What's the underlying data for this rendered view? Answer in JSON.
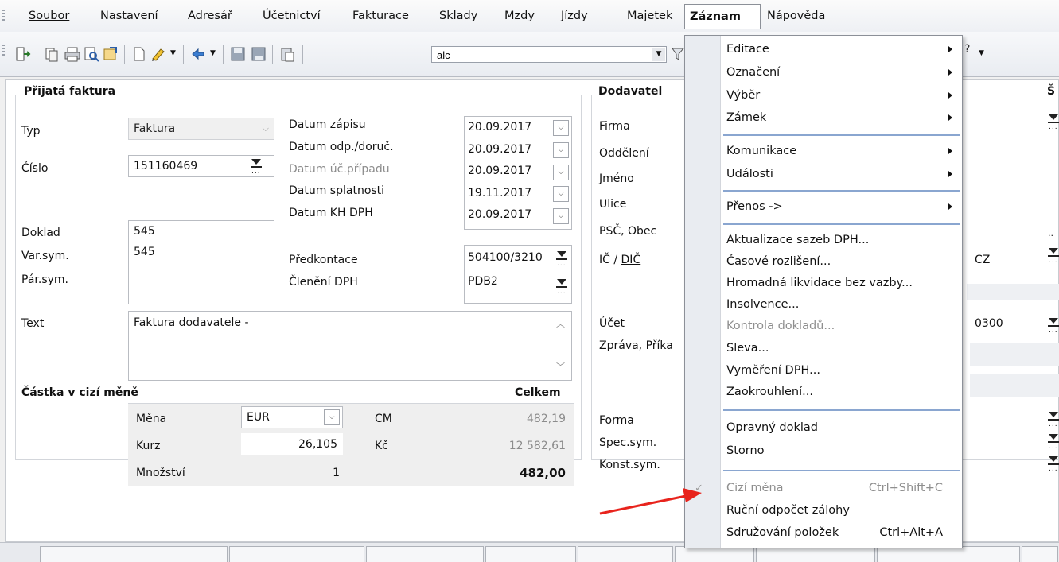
{
  "menubar": {
    "items": [
      "Soubor",
      "Nastavení",
      "Adresář",
      "Účetnictví",
      "Fakturace",
      "Sklady",
      "Mzdy",
      "Jízdy",
      "Majetek",
      "Záznam",
      "Nápověda"
    ],
    "active": "Záznam"
  },
  "toolbar": {
    "search_value": "alc"
  },
  "invoice": {
    "section_title": "Přijatá faktura",
    "typ_label": "Typ",
    "typ_value": "Faktura",
    "cislo_label": "Číslo",
    "cislo_value": "151160469",
    "doklad_label": "Doklad",
    "doklad_value": "545",
    "varsym_label": "Var.sym.",
    "varsym_value": "545",
    "parsym_label": "Pár.sym.",
    "parsym_value": "",
    "text_label": "Text",
    "text_value": "Faktura dodavatele -",
    "dates": [
      {
        "label": "Datum zápisu",
        "value": "20.09.2017",
        "dim": false
      },
      {
        "label": "Datum odp./doruč.",
        "value": "20.09.2017",
        "dim": false
      },
      {
        "label": "Datum úč.případu",
        "value": "20.09.2017",
        "dim": true
      },
      {
        "label": "Datum splatnosti",
        "value": "19.11.2017",
        "dim": false
      },
      {
        "label": "Datum KH DPH",
        "value": "20.09.2017",
        "dim": false
      }
    ],
    "predkontace_label": "Předkontace",
    "predkontace_value": "504100/3210",
    "cleneni_label": "Členění DPH",
    "cleneni_value": "PDB2"
  },
  "currency": {
    "section_title": "Částka v cizí měně",
    "celkem_label": "Celkem",
    "mena_label": "Měna",
    "mena_value": "EUR",
    "cm_label": "CM",
    "cm_value": "482,19",
    "kurz_label": "Kurz",
    "kurz_value": "26,105",
    "kc_label": "Kč",
    "kc_value": "12 582,61",
    "mnozstvi_label": "Množství",
    "mnozstvi_value": "1",
    "total_value": "482,00"
  },
  "supplier": {
    "section_title": "Dodavatel",
    "labels": [
      "Firma",
      "Oddělení",
      "Jméno",
      "Ulice",
      "PSČ, Obec"
    ],
    "ic_label": "IČ / ",
    "dic_label": "DIČ",
    "country_value": "CZ",
    "ucet_label": "Účet",
    "ucet_value": "0300",
    "zprava_label": "Zpráva, Příka",
    "forma_label": "Forma",
    "specsym_label": "Spec.sym.",
    "konstsym_label": "Konst.sym.",
    "right_header_fragment": "Š"
  },
  "zaznam_menu": {
    "items": [
      {
        "label": "Editace",
        "submenu": true
      },
      {
        "label": "Označení",
        "submenu": true
      },
      {
        "label": "Výběr",
        "submenu": true
      },
      {
        "label": "Zámek",
        "submenu": true
      },
      {
        "label": "Komunikace",
        "submenu": true
      },
      {
        "label": "Události",
        "submenu": true
      },
      {
        "label": "Přenos ->",
        "submenu": true
      },
      {
        "label": "Aktualizace sazeb DPH..."
      },
      {
        "label": "Časové rozlišení..."
      },
      {
        "label": "Hromadná likvidace bez vazby..."
      },
      {
        "label": "Insolvence..."
      },
      {
        "label": "Kontrola dokladů...",
        "disabled": true
      },
      {
        "label": "Sleva..."
      },
      {
        "label": "Vyměření DPH..."
      },
      {
        "label": "Zaokrouhlení..."
      },
      {
        "label": "Opravný doklad"
      },
      {
        "label": "Storno"
      },
      {
        "label": "Cizí měna",
        "disabled": true,
        "checked": true,
        "shortcut": "Ctrl+Shift+C"
      },
      {
        "label": "Ruční odpočet zálohy"
      },
      {
        "label": "Sdružování položek",
        "shortcut": "Ctrl+Alt+A"
      }
    ]
  },
  "colors": {
    "arrow": "#e8231c",
    "separator": "#8aa6d0",
    "menu_strip": "#e9ecf1"
  }
}
